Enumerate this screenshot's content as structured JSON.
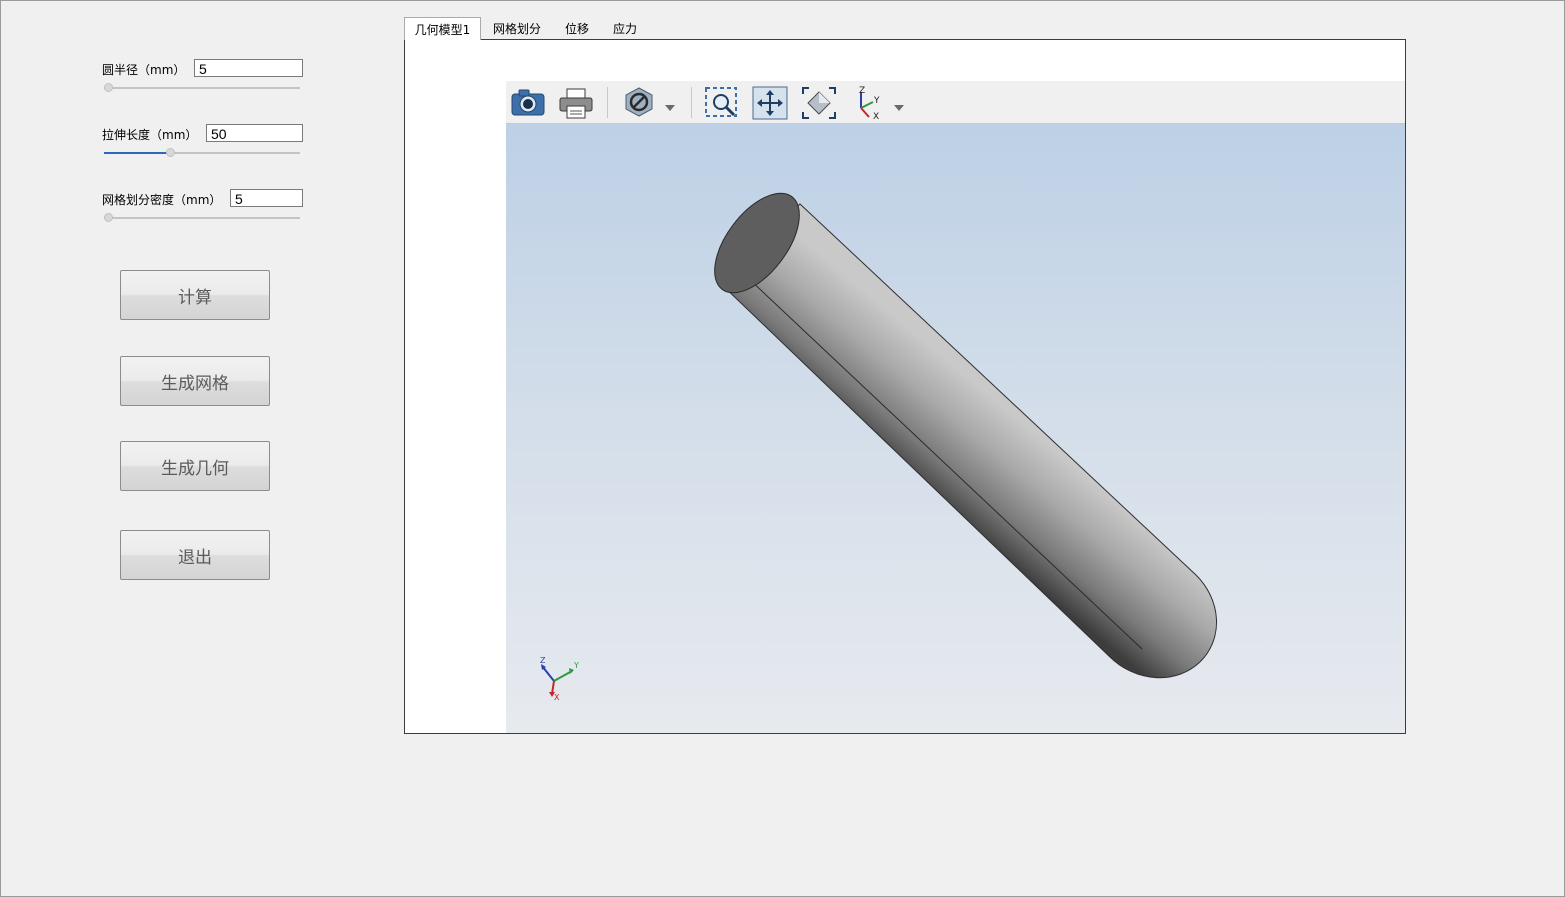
{
  "controls": {
    "radius": {
      "label": "圆半径（mm）",
      "value": "5",
      "slider_fraction": 0.0
    },
    "length": {
      "label": "拉伸长度（mm）",
      "value": "50",
      "slider_fraction": 0.33
    },
    "mesh": {
      "label": "网格划分密度（mm）",
      "value": "5",
      "slider_fraction": 0.0
    }
  },
  "buttons": {
    "compute": "计算",
    "gen_mesh": "生成网格",
    "gen_geom": "生成几何",
    "exit": "退出"
  },
  "tabs": [
    {
      "label": "几何模型1",
      "active": true
    },
    {
      "label": "网格划分",
      "active": false
    },
    {
      "label": "位移",
      "active": false
    },
    {
      "label": "应力",
      "active": false
    }
  ],
  "toolbar": {
    "icons": [
      "camera-icon",
      "print-icon",
      "display-mode-icon",
      "zoom-window-icon",
      "pan-icon",
      "fit-all-icon",
      "axes-view-icon"
    ]
  },
  "triad": {
    "z": "Z",
    "y": "Y",
    "x": "X"
  },
  "colors": {
    "background": "#f0f0f0",
    "scene_top": "#bdd0e6",
    "scene_bottom": "#e7eaef",
    "slider_fill": "#2a6ab8"
  }
}
